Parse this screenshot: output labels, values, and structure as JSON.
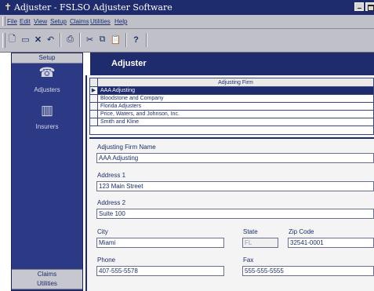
{
  "window": {
    "app_icon": "✝",
    "title": "Adjuster - FSLSO Adjuster Software"
  },
  "menu": [
    {
      "label": "File"
    },
    {
      "label": "Edit"
    },
    {
      "label": "View"
    },
    {
      "label": "Setup"
    },
    {
      "label": "Claims"
    },
    {
      "label": "Utilities"
    },
    {
      "label": "Help"
    }
  ],
  "toolbar": {
    "new_icon": "🗋",
    "save_icon": "▭",
    "delete_icon": "✕",
    "undo_icon": "↶",
    "print_icon": "⎙",
    "cut_icon": "✂",
    "copy_icon": "⧉",
    "paste_icon": "📋",
    "help_icon": "?"
  },
  "sidebar": {
    "setup_header": "Setup",
    "adjusters_label": "Adjusters",
    "adjusters_icon": "☎",
    "insurers_label": "Insurers",
    "insurers_icon": "▥",
    "claims_header": "Claims",
    "utilities_header": "Utilities"
  },
  "main": {
    "title": "Adjuster"
  },
  "grid": {
    "column_header": "Adjusting Firm",
    "current_row_marker": "▶",
    "rows": [
      {
        "name": "AAA Adjusting",
        "selected": true
      },
      {
        "name": "Bloodstone and Company",
        "selected": false
      },
      {
        "name": "Florida Adjusters",
        "selected": false
      },
      {
        "name": "Price, Waters, and Johnson, Inc.",
        "selected": false
      },
      {
        "name": "Smith and Kline",
        "selected": false
      }
    ]
  },
  "form": {
    "firm_name_label": "Adjusting Firm Name",
    "firm_name_value": "AAA Adjusting",
    "address1_label": "Address 1",
    "address1_value": "123 Main Street",
    "address2_label": "Address 2",
    "address2_value": "Suite 100",
    "city_label": "City",
    "city_value": "Miami",
    "state_label": "State",
    "state_value": "FL",
    "zip_label": "Zip Code",
    "zip_value": "32541-0001",
    "phone_label": "Phone",
    "phone_value": "407-555-5578",
    "fax_label": "Fax",
    "fax_value": "555-555-5555"
  },
  "colors": {
    "accent": "#1e2b6c",
    "sidebar": "#2c3a85",
    "chrome": "#c0c0c8"
  }
}
